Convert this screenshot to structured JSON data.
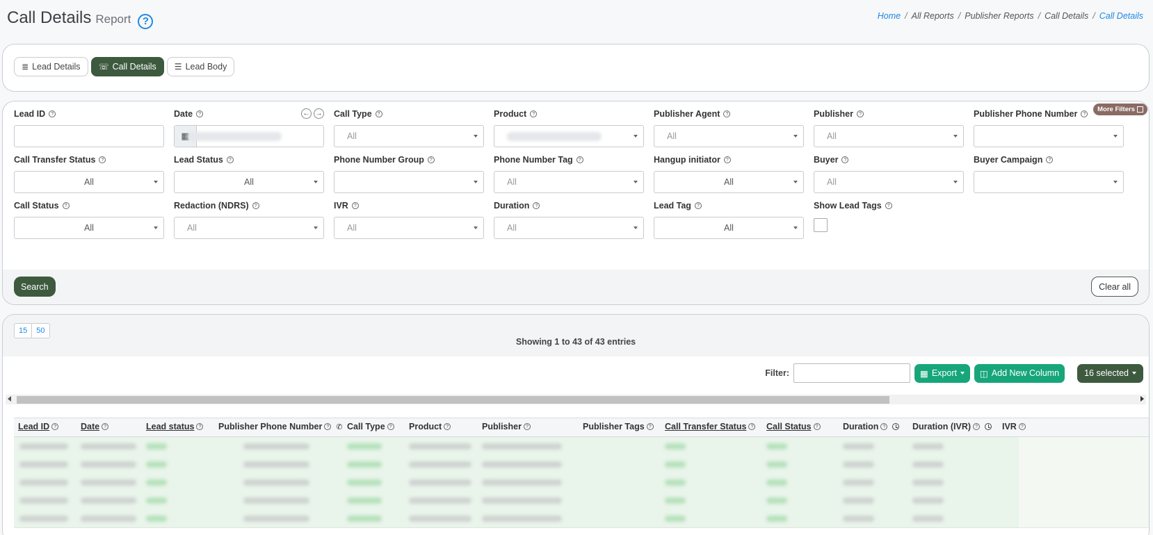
{
  "header": {
    "title": "Call Details",
    "subtitle": "Report",
    "help_glyph": "?",
    "breadcrumb": [
      {
        "label": "Home",
        "link": true
      },
      {
        "label": "All Reports",
        "link": false
      },
      {
        "label": "Publisher Reports",
        "link": false
      },
      {
        "label": "Call Details",
        "link": false
      },
      {
        "label": "Call Details",
        "link": true
      }
    ]
  },
  "tabs": [
    {
      "label": "Lead Details",
      "icon": "list-icon",
      "active": false
    },
    {
      "label": "Call Details",
      "icon": "call-monitor-icon",
      "active": true
    },
    {
      "label": "Lead Body",
      "icon": "bullet-list-icon",
      "active": false
    }
  ],
  "filters": {
    "more_filters_label": "More Filters",
    "rows": [
      [
        {
          "label": "Lead ID",
          "type": "input",
          "value": ""
        },
        {
          "label": "Date",
          "type": "date",
          "value": ""
        },
        {
          "label": "Call Type",
          "type": "select",
          "value": "All"
        },
        {
          "label": "Product",
          "type": "select",
          "value": ""
        },
        {
          "label": "Publisher Agent",
          "type": "select",
          "value": "All"
        },
        {
          "label": "Publisher",
          "type": "select",
          "value": "All"
        },
        {
          "label": "Publisher Phone Number",
          "type": "select",
          "value": ""
        }
      ],
      [
        {
          "label": "Call Transfer Status",
          "type": "select-center",
          "value": "All"
        },
        {
          "label": "Lead Status",
          "type": "select-center",
          "value": "All"
        },
        {
          "label": "Phone Number Group",
          "type": "select",
          "value": ""
        },
        {
          "label": "Phone Number Tag",
          "type": "select",
          "value": "All"
        },
        {
          "label": "Hangup initiator",
          "type": "select-center",
          "value": "All"
        },
        {
          "label": "Buyer",
          "type": "select",
          "value": "All"
        },
        {
          "label": "Buyer Campaign",
          "type": "select",
          "value": ""
        }
      ],
      [
        {
          "label": "Call Status",
          "type": "select-center",
          "value": "All"
        },
        {
          "label": "Redaction (NDRS)",
          "type": "select",
          "value": "All"
        },
        {
          "label": "IVR",
          "type": "select",
          "value": "All"
        },
        {
          "label": "Duration",
          "type": "select",
          "value": "All"
        },
        {
          "label": "Lead Tag",
          "type": "select-center",
          "value": "All"
        },
        {
          "label": "Show Lead Tags",
          "type": "checkbox",
          "value": ""
        }
      ]
    ],
    "search_label": "Search",
    "clear_label": "Clear all"
  },
  "table": {
    "page_sizes": [
      "15",
      "50"
    ],
    "showing_text": "Showing 1 to 43 of 43 entries",
    "filter_label": "Filter:",
    "export_label": "Export",
    "add_column_label": "Add New Column",
    "selected_label": "16 selected",
    "columns": [
      {
        "label": "Lead ID",
        "sortable": true,
        "extra": ""
      },
      {
        "label": "Date",
        "sortable": true,
        "extra": ""
      },
      {
        "label": "Lead status",
        "sortable": true,
        "extra": ""
      },
      {
        "label": "Publisher Phone Number",
        "sortable": false,
        "extra": "phone"
      },
      {
        "label": "Call Type",
        "sortable": false,
        "extra": ""
      },
      {
        "label": "Product",
        "sortable": false,
        "extra": ""
      },
      {
        "label": "Publisher",
        "sortable": false,
        "extra": ""
      },
      {
        "label": "Publisher Tags",
        "sortable": false,
        "extra": ""
      },
      {
        "label": "Call Transfer Status",
        "sortable": true,
        "extra": ""
      },
      {
        "label": "Call Status",
        "sortable": true,
        "extra": ""
      },
      {
        "label": "Duration",
        "sortable": false,
        "extra": "clock"
      },
      {
        "label": "Duration (IVR)",
        "sortable": false,
        "extra": "clock"
      },
      {
        "label": "IVR",
        "sortable": false,
        "extra": ""
      }
    ],
    "visible_row_count": 5
  },
  "colors": {
    "primary_dark_green": "#3d5a3f",
    "accent_green": "#17a67a",
    "link_blue": "#1e88e5",
    "more_filters_brown": "#8a6b63"
  }
}
